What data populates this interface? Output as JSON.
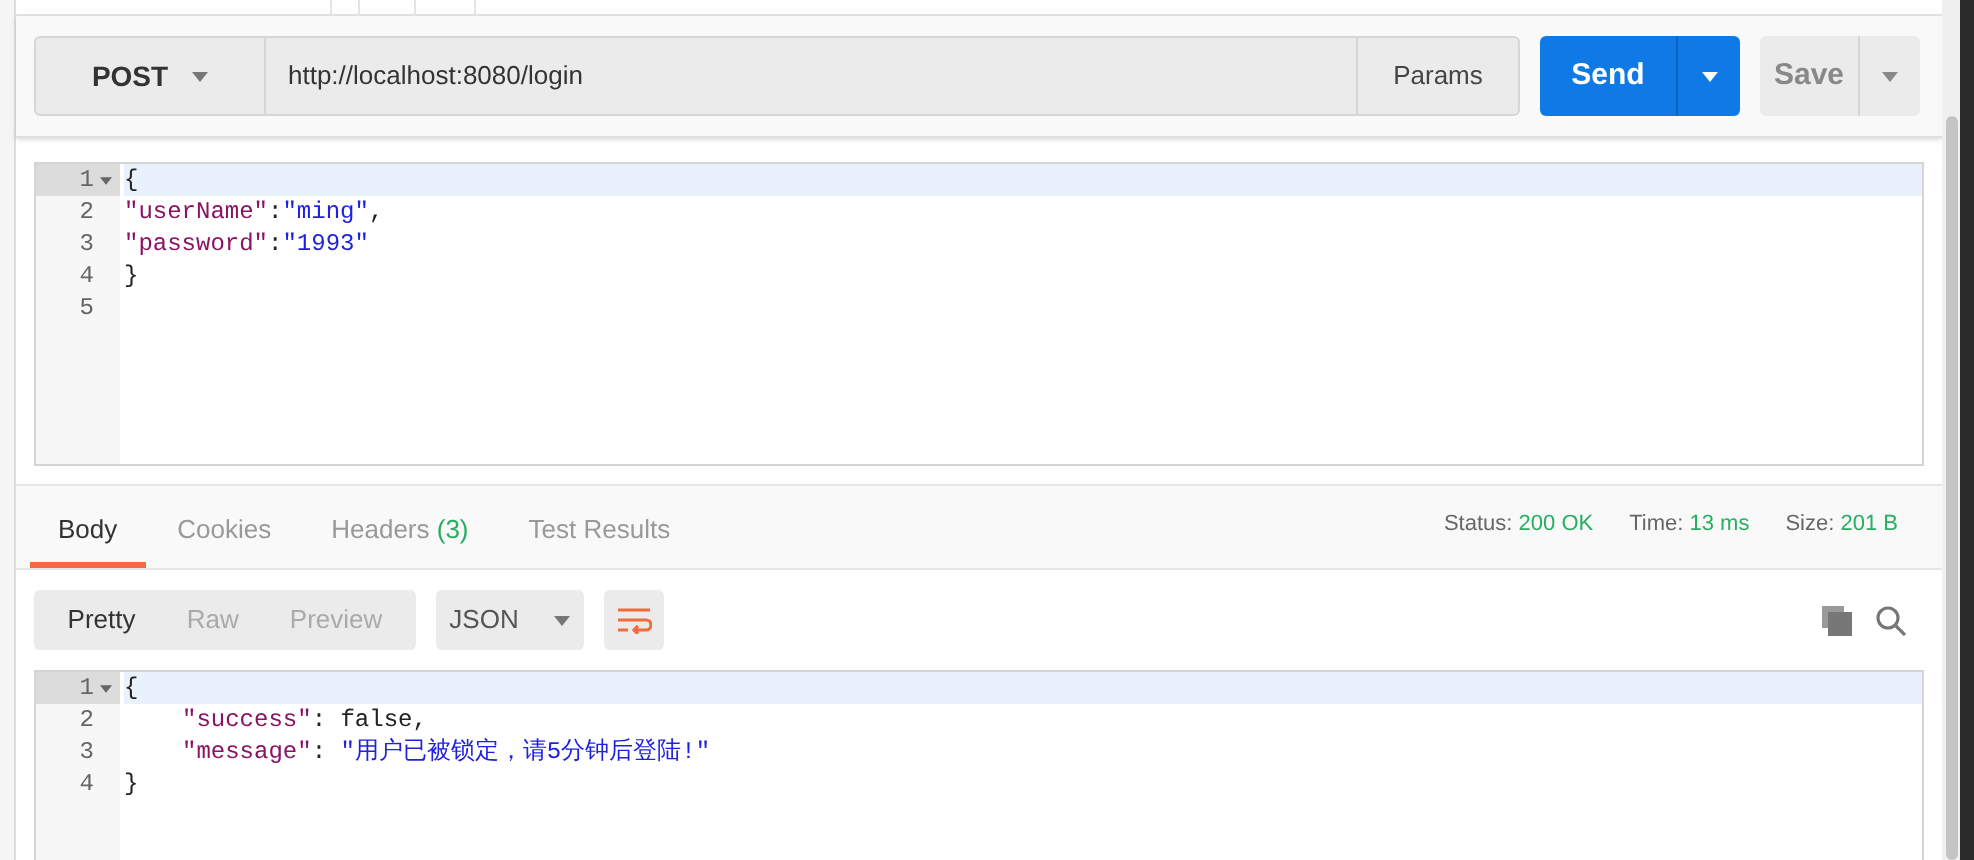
{
  "request": {
    "method": "POST",
    "url": "http://localhost:8080/login",
    "params_label": "Params",
    "send_label": "Send",
    "save_label": "Save"
  },
  "request_body": {
    "lines": [
      {
        "number": "1",
        "active": true,
        "foldable": true,
        "indented": false,
        "tokens": [
          {
            "kind": "punct",
            "text": "{"
          }
        ]
      },
      {
        "number": "2",
        "active": false,
        "foldable": false,
        "indented": false,
        "tokens": [
          {
            "kind": "key",
            "text": "\"userName\""
          },
          {
            "kind": "punct",
            "text": ":"
          },
          {
            "kind": "string",
            "text": "\"ming\""
          },
          {
            "kind": "punct",
            "text": ","
          }
        ]
      },
      {
        "number": "3",
        "active": false,
        "foldable": false,
        "indented": false,
        "tokens": [
          {
            "kind": "key",
            "text": "\"password\""
          },
          {
            "kind": "punct",
            "text": ":"
          },
          {
            "kind": "string",
            "text": "\"1993\""
          }
        ]
      },
      {
        "number": "4",
        "active": false,
        "foldable": false,
        "indented": false,
        "tokens": [
          {
            "kind": "punct",
            "text": "}"
          }
        ]
      },
      {
        "number": "5",
        "active": false,
        "foldable": false
      }
    ]
  },
  "response_tabs": [
    {
      "label": "Body",
      "selected": true
    },
    {
      "label": "Cookies",
      "selected": false
    },
    {
      "label": "Headers",
      "count": "(3)",
      "selected": false
    },
    {
      "label": "Test Results",
      "selected": false
    }
  ],
  "response_meta": [
    {
      "label": "Status:",
      "value": "200 OK"
    },
    {
      "label": "Time:",
      "value": "13 ms"
    },
    {
      "label": "Size:",
      "value": "201 B"
    }
  ],
  "view_modes": [
    {
      "label": "Pretty",
      "selected": true
    },
    {
      "label": "Raw",
      "selected": false
    },
    {
      "label": "Preview",
      "selected": false
    }
  ],
  "format": "JSON",
  "response_body": {
    "lines": [
      {
        "number": "1",
        "active": true,
        "foldable": true,
        "indented": false,
        "tokens": [
          {
            "kind": "punct",
            "text": "{"
          }
        ]
      },
      {
        "number": "2",
        "active": false,
        "foldable": false,
        "indented": true,
        "tokens": [
          {
            "kind": "key",
            "text": "\"success\""
          },
          {
            "kind": "punct",
            "text": ": "
          },
          {
            "kind": "bool",
            "text": "false"
          },
          {
            "kind": "punct",
            "text": ","
          }
        ]
      },
      {
        "number": "3",
        "active": false,
        "foldable": false,
        "indented": true,
        "tokens": [
          {
            "kind": "key",
            "text": "\"message\""
          },
          {
            "kind": "punct",
            "text": ": "
          },
          {
            "kind": "string",
            "text": "\"用户已被锁定，请5分钟后登陆!\""
          }
        ]
      },
      {
        "number": "4",
        "active": false,
        "foldable": false,
        "indented": false,
        "tokens": [
          {
            "kind": "punct",
            "text": "}"
          }
        ]
      }
    ]
  }
}
